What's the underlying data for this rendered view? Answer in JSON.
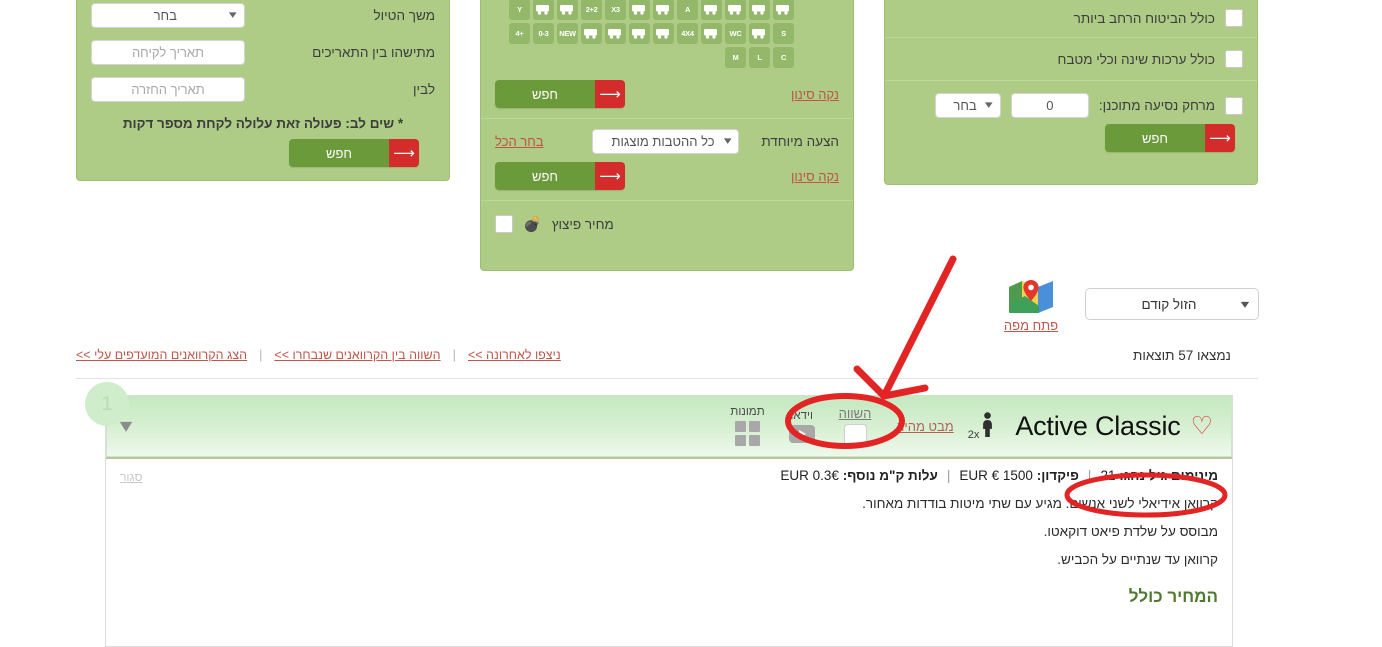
{
  "theme": {
    "panel_bg": "#aecc86",
    "accent_green": "#6a9a3a",
    "accent_red": "#d42b2b",
    "link_red": "#c0554a",
    "card_header_green": "#c4e8c0",
    "annotation_red": "#e32424"
  },
  "left_panel": {
    "fields": [
      {
        "label": "משך הטיול",
        "value": "בחר",
        "type": "select"
      },
      {
        "label": "מתישהו בין התאריכים",
        "value": "תאריך לקיחה",
        "type": "date"
      },
      {
        "label": "לבין",
        "value": "תאריך החזרה",
        "type": "date"
      }
    ],
    "note": "* שים לב: פעולה זאת עלולה לקחת מספר דקות",
    "search_label": "חפש"
  },
  "middle_panel": {
    "feature_icons": [
      {
        "name": "van-icon",
        "tag": ""
      },
      {
        "name": "camper-arrow-icon",
        "tag": ""
      },
      {
        "name": "camper-plus-icon",
        "tag": ""
      },
      {
        "name": "wheelchair-icon",
        "tag": ""
      },
      {
        "name": "automatic-transmission-icon",
        "tag": "A"
      },
      {
        "name": "length-arrows-icon",
        "tag": ""
      },
      {
        "name": "family-plus-icon",
        "tag": ""
      },
      {
        "name": "occupancy-x3-icon",
        "tag": "X3"
      },
      {
        "name": "occupancy-2plus2-icon",
        "tag": "2+2"
      },
      {
        "name": "person-plus-icon",
        "tag": ""
      },
      {
        "name": "gear-icon",
        "tag": ""
      },
      {
        "name": "search-y-icon",
        "tag": "Y"
      },
      {
        "name": "camper-s-icon",
        "tag": "S"
      },
      {
        "name": "shower-icon",
        "tag": ""
      },
      {
        "name": "wc-icon",
        "tag": "WC"
      },
      {
        "name": "truck-icon",
        "tag": ""
      },
      {
        "name": "fourbyfour-icon",
        "tag": "4X4"
      },
      {
        "name": "electric-icon",
        "tag": ""
      },
      {
        "name": "bed-icon",
        "tag": ""
      },
      {
        "name": "tv-icon",
        "tag": ""
      },
      {
        "name": "family-icon",
        "tag": ""
      },
      {
        "name": "new-icon",
        "tag": "NEW"
      },
      {
        "name": "camper-0-3-icon",
        "tag": "0-3"
      },
      {
        "name": "camper-plus4-icon",
        "tag": "+4"
      },
      {
        "name": "search-c-icon",
        "tag": "C"
      },
      {
        "name": "camper-l-icon",
        "tag": "L"
      },
      {
        "name": "camper-m-icon",
        "tag": "M"
      }
    ],
    "clear_filter_label": "נקה סינון",
    "search_label": "חפש",
    "special_offer_label": "הצעה מיוחדת",
    "offer_select_value": "כל ההטבות מוצגות",
    "select_all_label": "בחר הכל",
    "clear_filter_label_2": "נקה סינון",
    "search_label_2": "חפש",
    "blast_price_label": "מחיר פיצוץ",
    "blast_price_icon": "bomb-icon"
  },
  "right_panel": {
    "rows": [
      {
        "label": "כולל הביטוח הרחב ביותר",
        "checked": false
      },
      {
        "label": "כולל ערכות שינה וכלי מטבח",
        "checked": false
      }
    ],
    "distance": {
      "label": "מרחק נסיעה מתוכנן:",
      "checked": false,
      "value": "0",
      "unit_value": "בחר"
    },
    "search_label": "חפש"
  },
  "results_bar": {
    "sort_value": "הזול קודם",
    "map_label": "פתח מפה",
    "map_icon": "map-pin-icon",
    "results_text": "נמצאו 57 תוצאות",
    "links": [
      "ניצפו לאחרונה >>",
      "השווה בין הקרוואנים שנבחרו >>",
      "הצג הקרוואנים המועדפים עלי >>"
    ]
  },
  "result_card": {
    "badge": "1",
    "favorite_icon": "heart-icon",
    "title": "Active Classic",
    "occupancy": "2x",
    "occupancy_icon": "person-icon",
    "quick_look_label": "מבט מהיר",
    "compare_label": "השווה",
    "video_label": "וידאו",
    "images_label": "תמונות",
    "expand_icon": "chevron-down-icon",
    "close_label": "סגור",
    "specs": [
      {
        "label": "מינימום גיל נהג:",
        "value": "21"
      },
      {
        "label": "פיקדון:",
        "value": "1500 € EUR"
      },
      {
        "label": "עלות ק\"מ נוסף:",
        "value": "0.3€ EUR"
      }
    ],
    "description": [
      "קרוואן אידיאלי לשני אנשים. מגיע עם שתי מיטות בודדות מאחור.",
      "מבוסס על שלדת פיאט דוקאטו.",
      "קרוואן עד שנתיים על הכביש."
    ],
    "price_includes_heading": "המחיר כולל"
  },
  "annotations": {
    "arrow_name": "red-arrow-annotation",
    "ellipse_quicklook_name": "red-ellipse-quicklook",
    "ellipse_minage_name": "red-ellipse-min-age"
  }
}
